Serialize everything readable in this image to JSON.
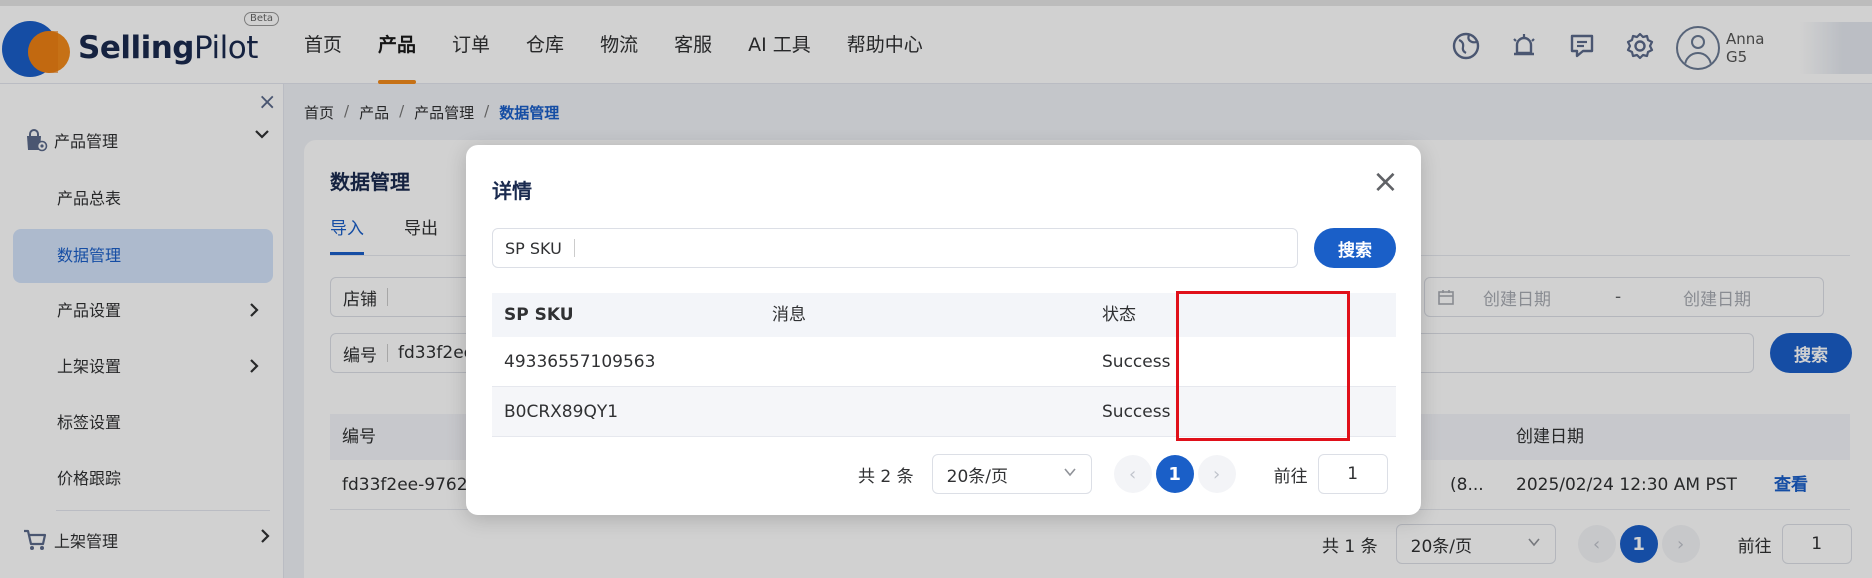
{
  "app": {
    "brand_bold": "Selling",
    "brand_light": "Pilot",
    "beta": "Beta"
  },
  "nav": {
    "items": [
      {
        "label": "首页",
        "active": false
      },
      {
        "label": "产品",
        "active": true
      },
      {
        "label": "订单",
        "active": false
      },
      {
        "label": "仓库",
        "active": false
      },
      {
        "label": "物流",
        "active": false
      },
      {
        "label": "客服",
        "active": false
      },
      {
        "label": "AI 工具",
        "active": false
      },
      {
        "label": "帮助中心",
        "active": false
      }
    ]
  },
  "user": {
    "name": "Anna",
    "sub": "G5"
  },
  "sidebar": {
    "close": "×",
    "group_product": "产品管理",
    "items": [
      {
        "label": "产品总表"
      },
      {
        "label": "数据管理"
      },
      {
        "label": "产品设置"
      },
      {
        "label": "上架设置"
      },
      {
        "label": "标签设置"
      },
      {
        "label": "价格跟踪"
      }
    ],
    "group_listing": "上架管理"
  },
  "breadcrumb": {
    "items": [
      "首页",
      "产品",
      "产品管理",
      "数据管理"
    ],
    "sep": "/"
  },
  "main": {
    "title": "数据管理",
    "tabs": [
      "导入",
      "导出"
    ],
    "filters": {
      "shop_label": "店铺",
      "code_label": "编号",
      "code_value": "fd33f2ee",
      "date_start_ph": "创建日期",
      "date_sep": "-",
      "date_end_ph": "创建日期",
      "search_btn": "搜索"
    },
    "table": {
      "col_code": "编号",
      "col_created": "创建日期",
      "row": {
        "code": "fd33f2ee-9762",
        "mid": "(8...",
        "created": "2025/02/24 12:30 AM PST",
        "action": "查看"
      }
    },
    "pager": {
      "total": "共 1 条",
      "page_size": "20条/页",
      "prev": "‹",
      "current": "1",
      "next": "›",
      "goto_label": "前往",
      "goto_value": "1"
    }
  },
  "modal": {
    "title": "详情",
    "close": "×",
    "search_label": "SP SKU",
    "search_btn": "搜索",
    "columns": [
      "SP SKU",
      "消息",
      "状态"
    ],
    "rows": [
      {
        "sku": "49336557109563",
        "message": "",
        "status": "Success"
      },
      {
        "sku": "B0CRX89QY1",
        "message": "",
        "status": "Success"
      }
    ],
    "pager": {
      "total": "共 2 条",
      "page_size": "20条/页",
      "prev": "‹",
      "current": "1",
      "next": "›",
      "goto_label": "前往",
      "goto_value": "1"
    }
  },
  "colors": {
    "primary": "#1a5fc8",
    "accent": "#f28a1b",
    "highlight": "#e0101a"
  }
}
